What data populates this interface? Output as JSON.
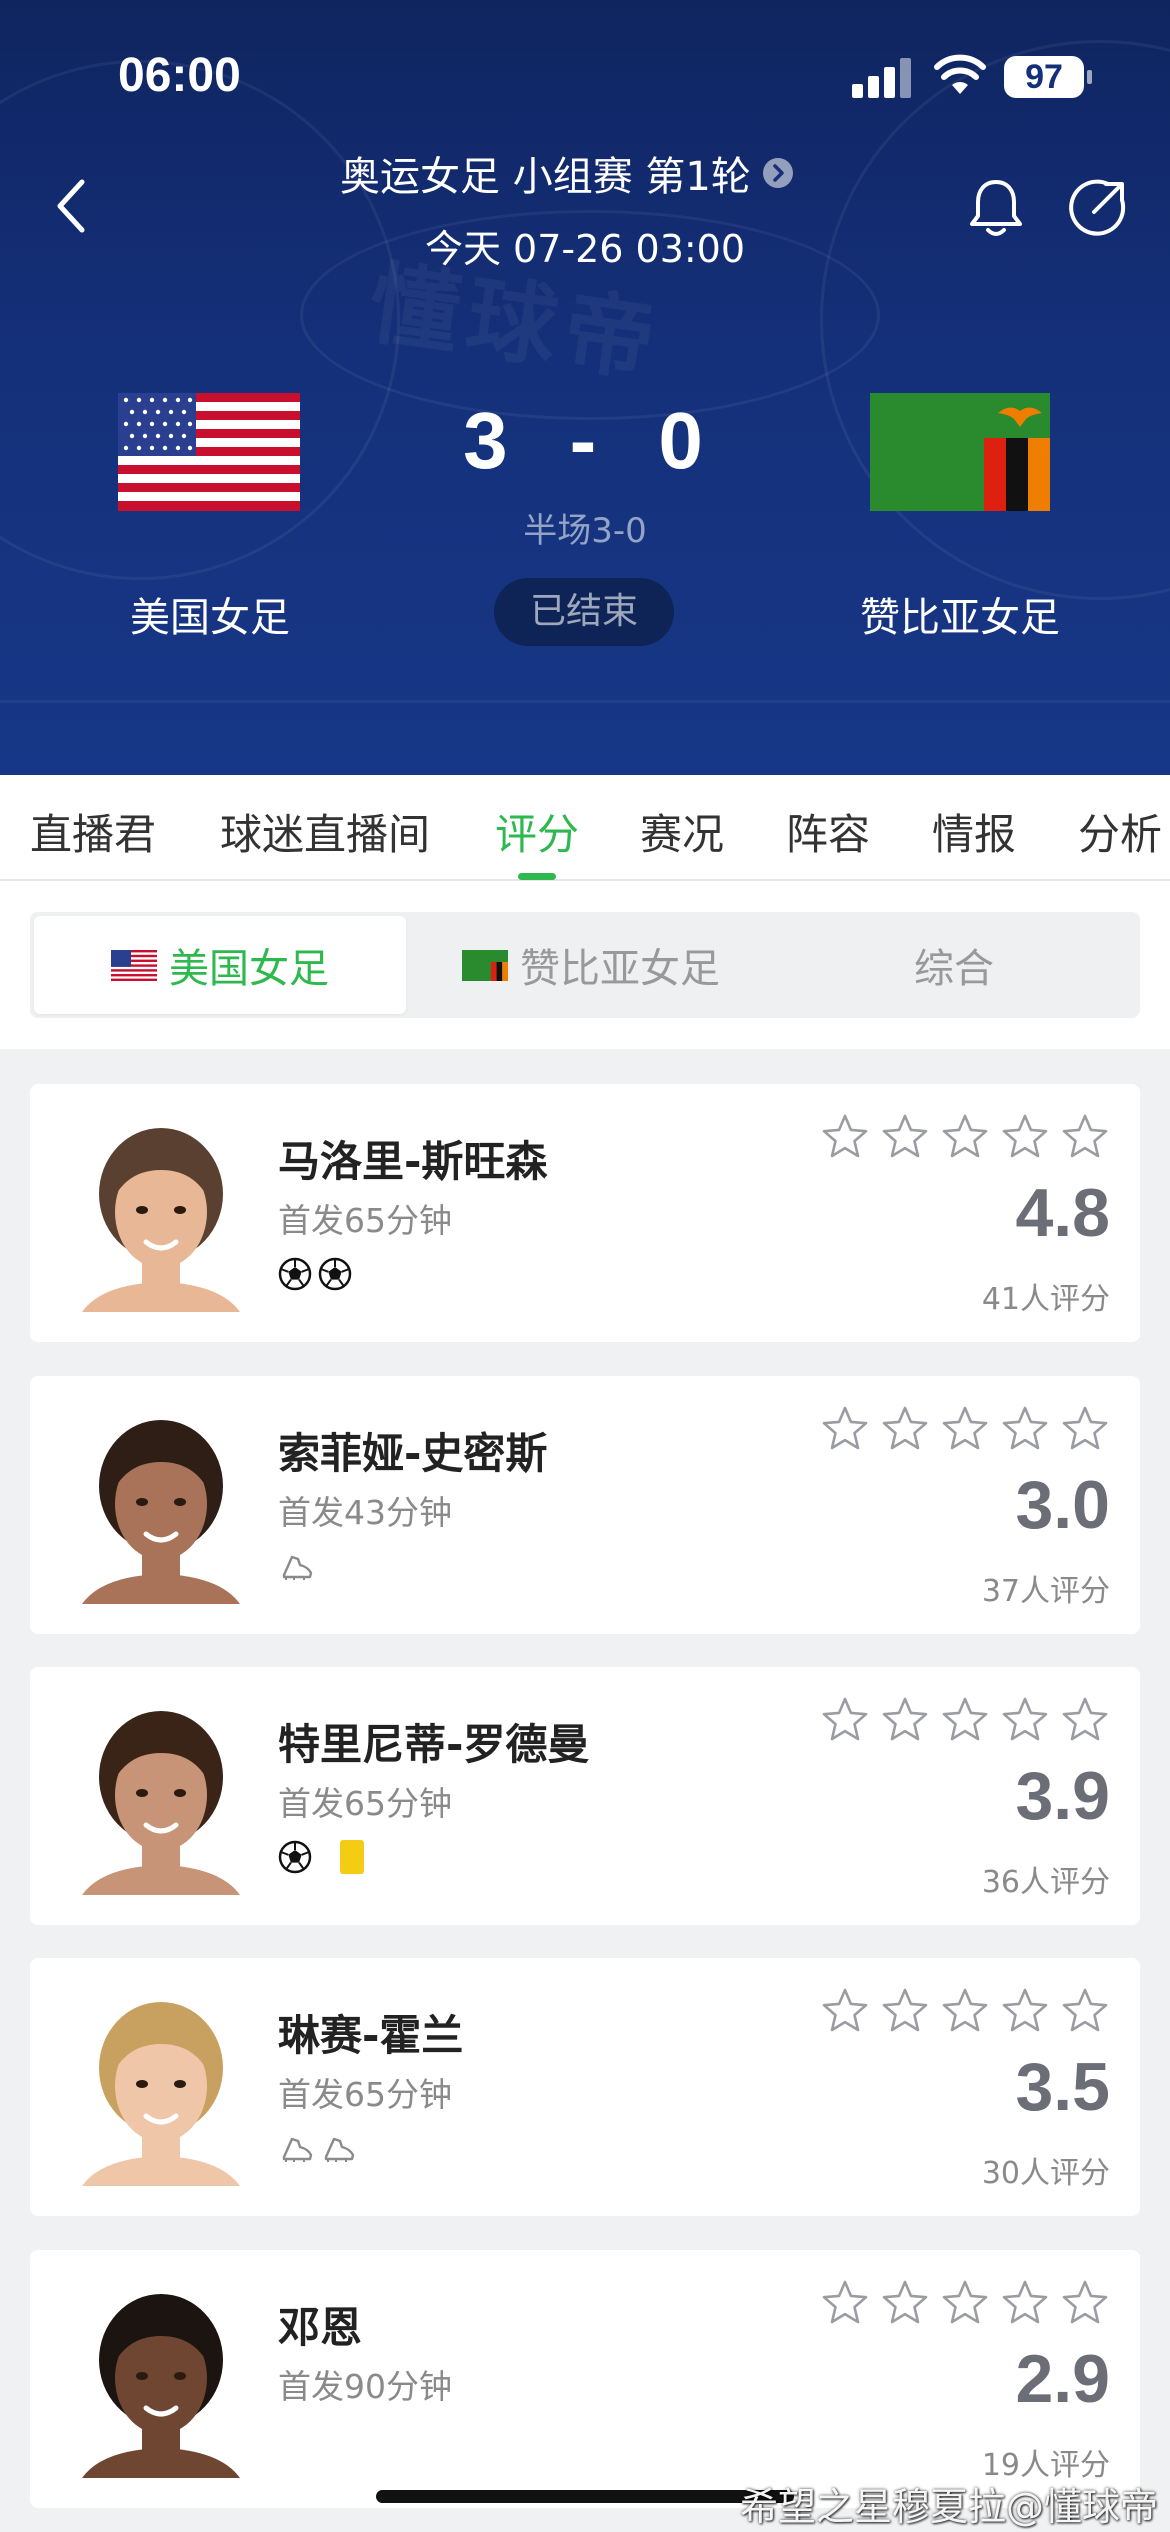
{
  "status_bar": {
    "time": "06:00",
    "battery": "97"
  },
  "match": {
    "competition": "奥运女足 小组赛 第1轮",
    "datetime": "今天 07-26 03:00",
    "home_team": "美国女足",
    "away_team": "赞比亚女足",
    "home_score": "3",
    "score_separator": "-",
    "away_score": "0",
    "halftime": "半场3-0",
    "status": "已结束"
  },
  "tabs": [
    "直播君",
    "球迷直播间",
    "评分",
    "赛况",
    "阵容",
    "情报",
    "分析"
  ],
  "active_tab": "评分",
  "segments": {
    "home": "美国女足",
    "away": "赞比亚女足",
    "overall": "综合"
  },
  "players": [
    {
      "name": "马洛里-斯旺森",
      "minutes": "首发65分钟",
      "events": [
        "goal",
        "goal"
      ],
      "rating": "4.8",
      "rating_count": "41人评分",
      "stars": 0
    },
    {
      "name": "索菲娅-史密斯",
      "minutes": "首发43分钟",
      "events": [
        "assist"
      ],
      "rating": "3.0",
      "rating_count": "37人评分",
      "stars": 0
    },
    {
      "name": "特里尼蒂-罗德曼",
      "minutes": "首发65分钟",
      "events": [
        "goal",
        "yellow-card"
      ],
      "rating": "3.9",
      "rating_count": "36人评分",
      "stars": 0
    },
    {
      "name": "琳赛-霍兰",
      "minutes": "首发65分钟",
      "events": [
        "assist",
        "assist"
      ],
      "rating": "3.5",
      "rating_count": "30人评分",
      "stars": 0
    },
    {
      "name": "邓恩",
      "minutes": "首发90分钟",
      "events": [],
      "rating": "2.9",
      "rating_count": "19人评分",
      "stars": 0
    }
  ],
  "watermark": "懂球帝",
  "credit": "希望之星穆夏拉@懂球帝",
  "colors": {
    "accent": "#2fb84d",
    "header_bg": "#15307a",
    "yellow_card": "#f5cc14"
  }
}
